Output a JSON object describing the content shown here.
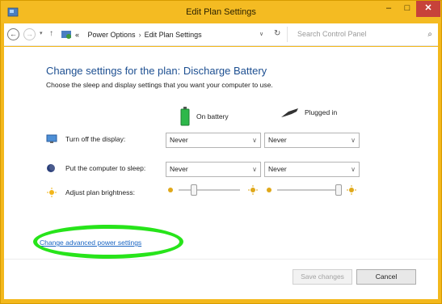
{
  "window": {
    "title": "Edit Plan Settings",
    "min": "–",
    "max": "□",
    "close": "✕"
  },
  "address": {
    "crumb_root": "«",
    "crumbs": [
      "Power Options",
      "Edit Plan Settings"
    ],
    "separator": "›",
    "dropdown": "∨",
    "refresh": "↻",
    "search_placeholder": "Search Control Panel",
    "search_icon": "⌕"
  },
  "page": {
    "heading": "Change settings for the plan: Discharge Battery",
    "subheading": "Choose the sleep and display settings that you want your computer to use.",
    "columns": {
      "battery": "On battery",
      "plugged": "Plugged in"
    },
    "rows": [
      {
        "label": "Turn off the display:",
        "battery": "Never",
        "plugged": "Never"
      },
      {
        "label": "Put the computer to sleep:",
        "battery": "Never",
        "plugged": "Never"
      },
      {
        "label": "Adjust plan brightness:"
      }
    ],
    "brightness": {
      "battery": 0.25,
      "plugged": 1.0
    },
    "advanced_link": "Change advanced power settings",
    "buttons": {
      "save": "Save changes",
      "cancel": "Cancel"
    }
  },
  "colors": {
    "titlebar": "#f4bb22",
    "heading": "#1d4f91",
    "link": "#1a65c3",
    "highlight": "#27e41a"
  }
}
